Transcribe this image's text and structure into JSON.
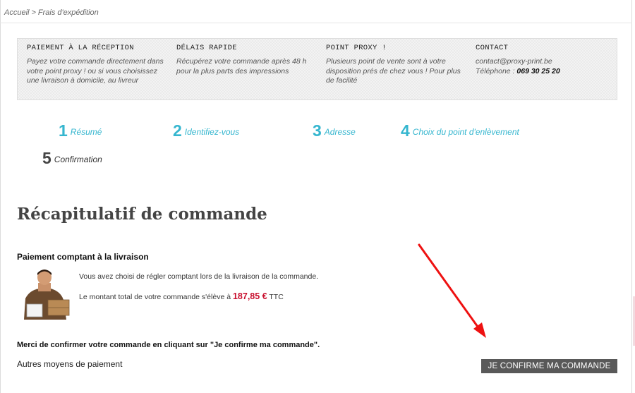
{
  "breadcrumb": {
    "home": "Accueil",
    "separator": ">",
    "current": "Frais d'expédition"
  },
  "info_panel": [
    {
      "title": "PAIEMENT À LA RÉCEPTION",
      "text": "Payez votre commande directement dans votre point proxy ! ou si vous choisissez une livraison à domicile, au livreur"
    },
    {
      "title": "DÉLAIS RAPIDE",
      "text": "Récupérez votre commande après 48 h pour la plus parts des impressions"
    },
    {
      "title": "POINT PROXY !",
      "text": "Plusieurs point de vente sont à votre disposition prés de chez vous ! Pour plus de facilité"
    },
    {
      "title": "CONTACT",
      "email": "contact@proxy-print.be",
      "phone_label": "Téléphone :",
      "phone": "069 30 25 20"
    }
  ],
  "steps": [
    {
      "num": "1",
      "label": "Résumé",
      "state": "done"
    },
    {
      "num": "2",
      "label": "Identifiez-vous",
      "state": "done"
    },
    {
      "num": "3",
      "label": "Adresse",
      "state": "done"
    },
    {
      "num": "4",
      "label": "Choix du point d'enlèvement",
      "state": "done"
    },
    {
      "num": "5",
      "label": "Confirmation",
      "state": "current"
    }
  ],
  "page_title": "Récapitulatif de commande",
  "payment": {
    "title": "Paiement comptant à la livraison",
    "line1": "Vous avez choisi de régler comptant lors de la livraison de la commande.",
    "line2_prefix": "Le montant total de votre commande s'élève à",
    "amount": "187,85 €",
    "currency_suffix": "TTC"
  },
  "confirm_message": "Merci de confirmer votre commande en cliquant sur \"Je confirme ma commande\".",
  "other_methods": "Autres moyens de paiement",
  "confirm_button": "JE CONFIRME MA COMMANDE",
  "colors": {
    "accent": "#35b6cf",
    "price": "#c8102e",
    "button": "#595959",
    "annotation_arrow": "#ee1111"
  },
  "icons": {
    "avatar": "delivery-man-image",
    "annotation": "red-arrow-icon"
  }
}
